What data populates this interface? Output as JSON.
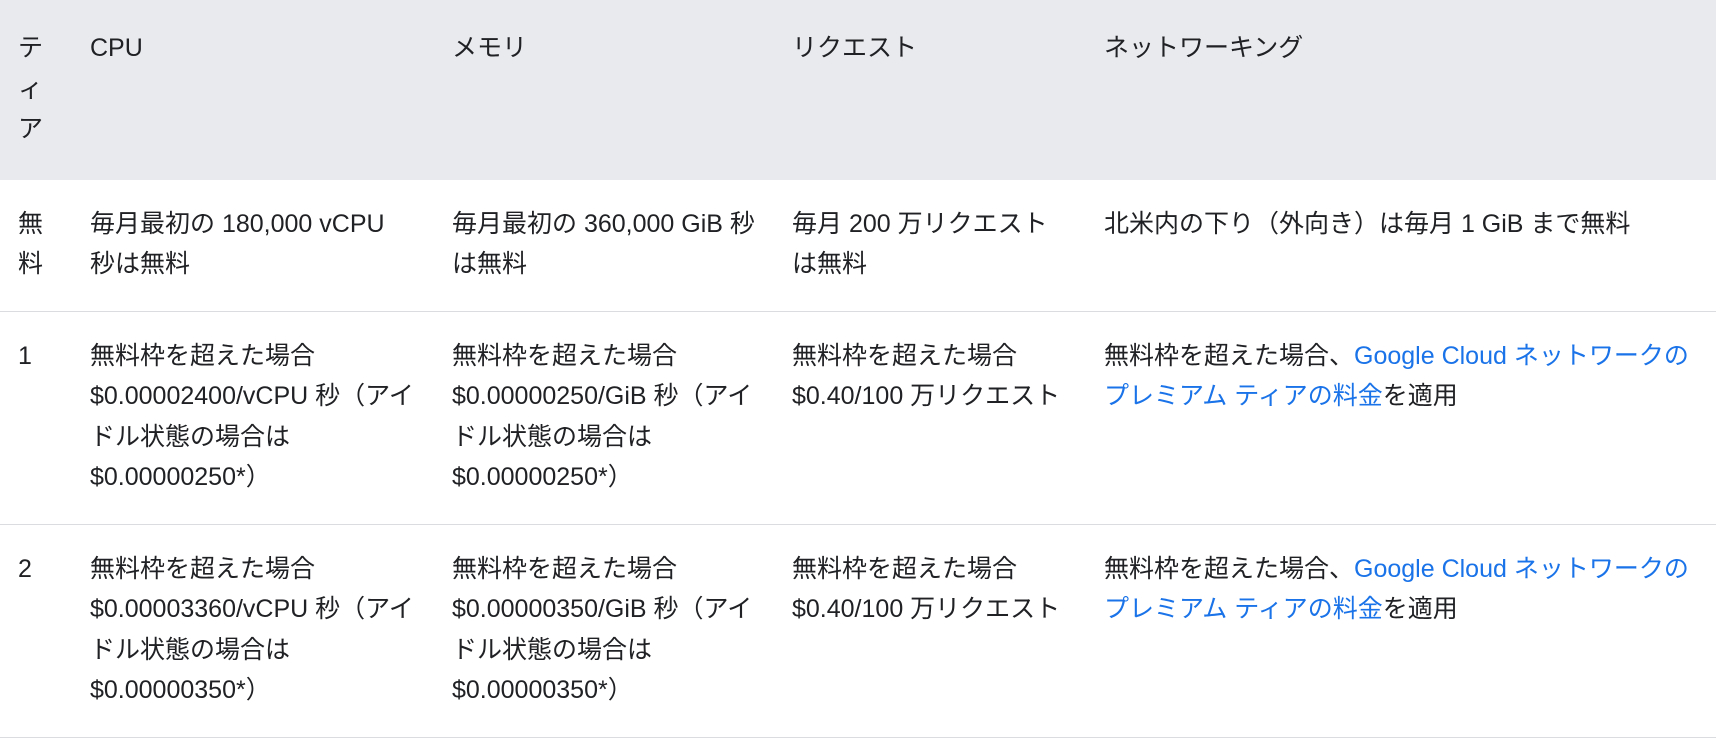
{
  "table": {
    "headers": [
      {
        "id": "tier",
        "label": "ティア"
      },
      {
        "id": "cpu",
        "label": "CPU"
      },
      {
        "id": "memory",
        "label": "メモリ"
      },
      {
        "id": "requests",
        "label": "リクエスト"
      },
      {
        "id": "networking",
        "label": "ネットワーキング"
      }
    ],
    "rows": [
      {
        "tier": "無料",
        "cpu": "毎月最初の 180,000 vCPU 秒は無料",
        "memory": "毎月最初の 360,000 GiB 秒は無料",
        "requests": "毎月 200 万リクエストは無料",
        "networking": {
          "prefix": "北米内の下り（外向き）は毎月 1 GiB まで無料",
          "link": "",
          "suffix": ""
        }
      },
      {
        "tier": "1",
        "cpu": "無料枠を超えた場合 $0.00002400/vCPU 秒（アイドル状態の場合は $0.00000250*）",
        "memory": "無料枠を超えた場合 $0.00000250/GiB 秒（アイドル状態の場合は $0.00000250*）",
        "requests": "無料枠を超えた場合 $0.40/100 万リクエスト",
        "networking": {
          "prefix": "無料枠を超えた場合、",
          "link": "Google Cloud ネットワークのプレミアム ティアの料金",
          "suffix": "を適用"
        }
      },
      {
        "tier": "2",
        "cpu": "無料枠を超えた場合 $0.00003360/vCPU 秒（アイドル状態の場合は $0.00000350*）",
        "memory": "無料枠を超えた場合 $0.00000350/GiB 秒（アイドル状態の場合は $0.00000350*）",
        "requests": "無料枠を超えた場合 $0.40/100 万リクエスト",
        "networking": {
          "prefix": "無料枠を超えた場合、",
          "link": "Google Cloud ネットワークのプレミアム ティアの料金",
          "suffix": "を適用"
        }
      }
    ]
  },
  "colors": {
    "header_background": "#e8eaed",
    "link": "#1a73e8",
    "text": "#202124",
    "row_divider": "#dadce0",
    "background": "#ffffff"
  }
}
